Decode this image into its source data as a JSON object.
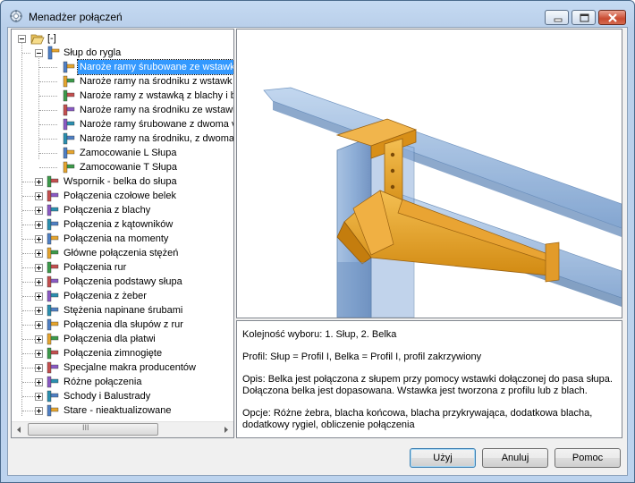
{
  "window": {
    "title": "Menadżer połączeń",
    "accent": "#c5daf2"
  },
  "tree": {
    "root_label": "[-]",
    "group": {
      "label": "Słup do rygla",
      "children": [
        {
          "label": "Naroże ramy śrubowane ze wstawk",
          "icon": "frame-corner-bolted-icon",
          "selected": true
        },
        {
          "label": "Naroże ramy na środniku z wstawk",
          "icon": "frame-corner-web-icon"
        },
        {
          "label": "Naroże ramy z wstawką z blachy i b",
          "icon": "frame-corner-plate-icon"
        },
        {
          "label": "Naroże ramy na środniku ze wstawl",
          "icon": "frame-corner-web2-icon"
        },
        {
          "label": "Naroże ramy śrubowane z dwoma v",
          "icon": "frame-corner-double-icon"
        },
        {
          "label": "Naroże ramy na środniku, z dwoma",
          "icon": "frame-corner-web-double-icon"
        },
        {
          "label": "Zamocowanie L Słupa",
          "icon": "column-l-fixing-icon"
        },
        {
          "label": "Zamocowanie T Słupa",
          "icon": "column-t-fixing-icon"
        }
      ]
    },
    "categories": [
      {
        "label": "Wspornik - belka do słupa",
        "icon": "bracket-beam-icon"
      },
      {
        "label": "Połączenia czołowe belek",
        "icon": "end-plate-icon"
      },
      {
        "label": "Połączenia z blachy",
        "icon": "plate-connection-icon"
      },
      {
        "label": "Połączenia z kątowników",
        "icon": "angle-connection-icon"
      },
      {
        "label": "Połączenia na momenty",
        "icon": "moment-connection-icon"
      },
      {
        "label": "Główne połączenia stężeń",
        "icon": "bracing-icon"
      },
      {
        "label": "Połączenia rur",
        "icon": "pipe-connection-icon"
      },
      {
        "label": "Połączenia podstawy słupa",
        "icon": "base-plate-icon"
      },
      {
        "label": "Połączenia z żeber",
        "icon": "stiffener-icon"
      },
      {
        "label": "Stężenia napinane śrubami",
        "icon": "tension-bracing-icon"
      },
      {
        "label": "Połączenia dla słupów z rur",
        "icon": "tube-column-icon"
      },
      {
        "label": "Połączenia dla płatwi",
        "icon": "purlin-icon"
      },
      {
        "label": "Połączenia zimnogięte",
        "icon": "cold-formed-icon"
      },
      {
        "label": "Specjalne makra producentów",
        "icon": "manufacturer-macro-icon"
      },
      {
        "label": "Różne połączenia",
        "icon": "misc-connection-icon"
      },
      {
        "label": "Schody i Balustrady",
        "icon": "stairs-icon"
      },
      {
        "label": "Stare - nieaktualizowane",
        "icon": "obsolete-icon"
      }
    ],
    "scroll_grip": "III"
  },
  "description": {
    "selection_order": "Kolejność wyboru: 1. Słup, 2. Belka",
    "profile": "Profil: Słup = Profil I, Belka = Profil I, profil zakrzywiony",
    "description": "Opis: Belka jest połączona z słupem przy pomocy wstawki dołączonej do pasa słupa. Dołączona belka jest dopasowana. Wstawka jest tworzona z profilu lub z blach.",
    "options": "Opcje:  Różne żebra, blacha końcowa, blacha przykrywająca, dodatkowa blacha, dodatkowy rygiel, obliczenie połączenia"
  },
  "buttons": {
    "apply": "Użyj",
    "cancel": "Anuluj",
    "help": "Pomoc"
  }
}
